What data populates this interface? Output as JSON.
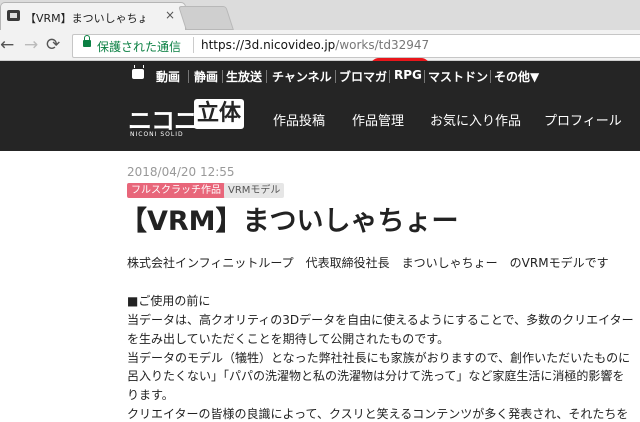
{
  "browser": {
    "tab_title": "【VRM】まついしゃちょー | ニ",
    "tab_close": "×",
    "secure_text": "保護された通信",
    "url_host": "https://3d.nicovideo.jp",
    "url_path": "/works/td32947"
  },
  "topnav": {
    "items": [
      "動画",
      "静画",
      "生放送",
      "チャンネル",
      "ブロマガ",
      "RPG",
      "マストドン",
      "その他▼"
    ]
  },
  "logo": {
    "nico": "ニコニ",
    "box": "立体",
    "sub": "NICONI SOLID"
  },
  "mainnav": {
    "items": [
      "作品投稿",
      "作品管理",
      "お気に入り作品",
      "プロフィール"
    ]
  },
  "work": {
    "date": "2018/04/20 12:55",
    "tags": [
      "フルスクラッチ作品",
      "VRMモデル"
    ],
    "title": "【VRM】まついしゃちょー",
    "author_line": "株式会社インフィニットループ　代表取締役社長　まついしゃちょー　のVRMモデルです",
    "body": [
      "■ご使用の前に",
      "当データは、高クオリティの3Dデータを自由に使えるようにすることで、多数のクリエイター",
      "を生み出していただくことを期待して公開されたものです。",
      "当データのモデル（犠牲）となった弊社社長にも家族がおりますので、創作いただいたものに",
      "呂入りたくない」「パパの洗濯物と私の洗濯物は分けて洗って」など家庭生活に消極的影響を",
      "ります。",
      "クリエイターの皆様の良識によって、クスリと笑えるコンテンツが多く発表され、それたちを"
    ]
  }
}
